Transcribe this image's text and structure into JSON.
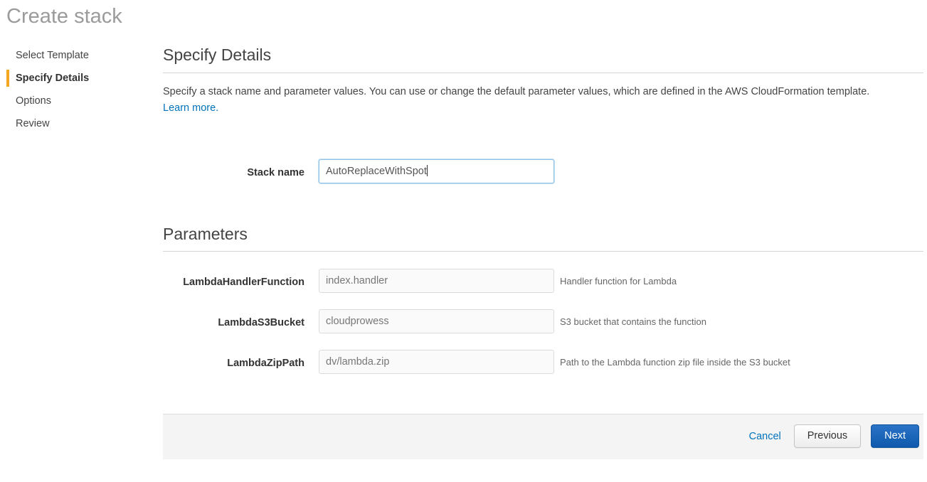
{
  "page": {
    "title": "Create stack"
  },
  "wizard": {
    "steps": [
      {
        "label": "Select Template",
        "active": false
      },
      {
        "label": "Specify Details",
        "active": true
      },
      {
        "label": "Options",
        "active": false
      },
      {
        "label": "Review",
        "active": false
      }
    ]
  },
  "details": {
    "heading": "Specify Details",
    "description": "Specify a stack name and parameter values. You can use or change the default parameter values, which are defined in the AWS CloudFormation template.",
    "learn_more_label": "Learn more.",
    "stack_name": {
      "label": "Stack name",
      "value": "AutoReplaceWithSpot",
      "focused": true
    }
  },
  "parameters": {
    "heading": "Parameters",
    "rows": [
      {
        "label": "LambdaHandlerFunction",
        "value": "index.handler",
        "help": "Handler function for Lambda"
      },
      {
        "label": "LambdaS3Bucket",
        "value": "cloudprowess",
        "help": "S3 bucket that contains the function"
      },
      {
        "label": "LambdaZipPath",
        "value": "dv/lambda.zip",
        "help": "Path to the Lambda function zip file inside the S3 bucket"
      }
    ]
  },
  "footer": {
    "cancel_label": "Cancel",
    "previous_label": "Previous",
    "next_label": "Next"
  },
  "colors": {
    "accent_orange": "#f5a623",
    "link_blue": "#0073bb",
    "primary_button": "#1565c0",
    "footer_background": "#f4f4f4"
  }
}
